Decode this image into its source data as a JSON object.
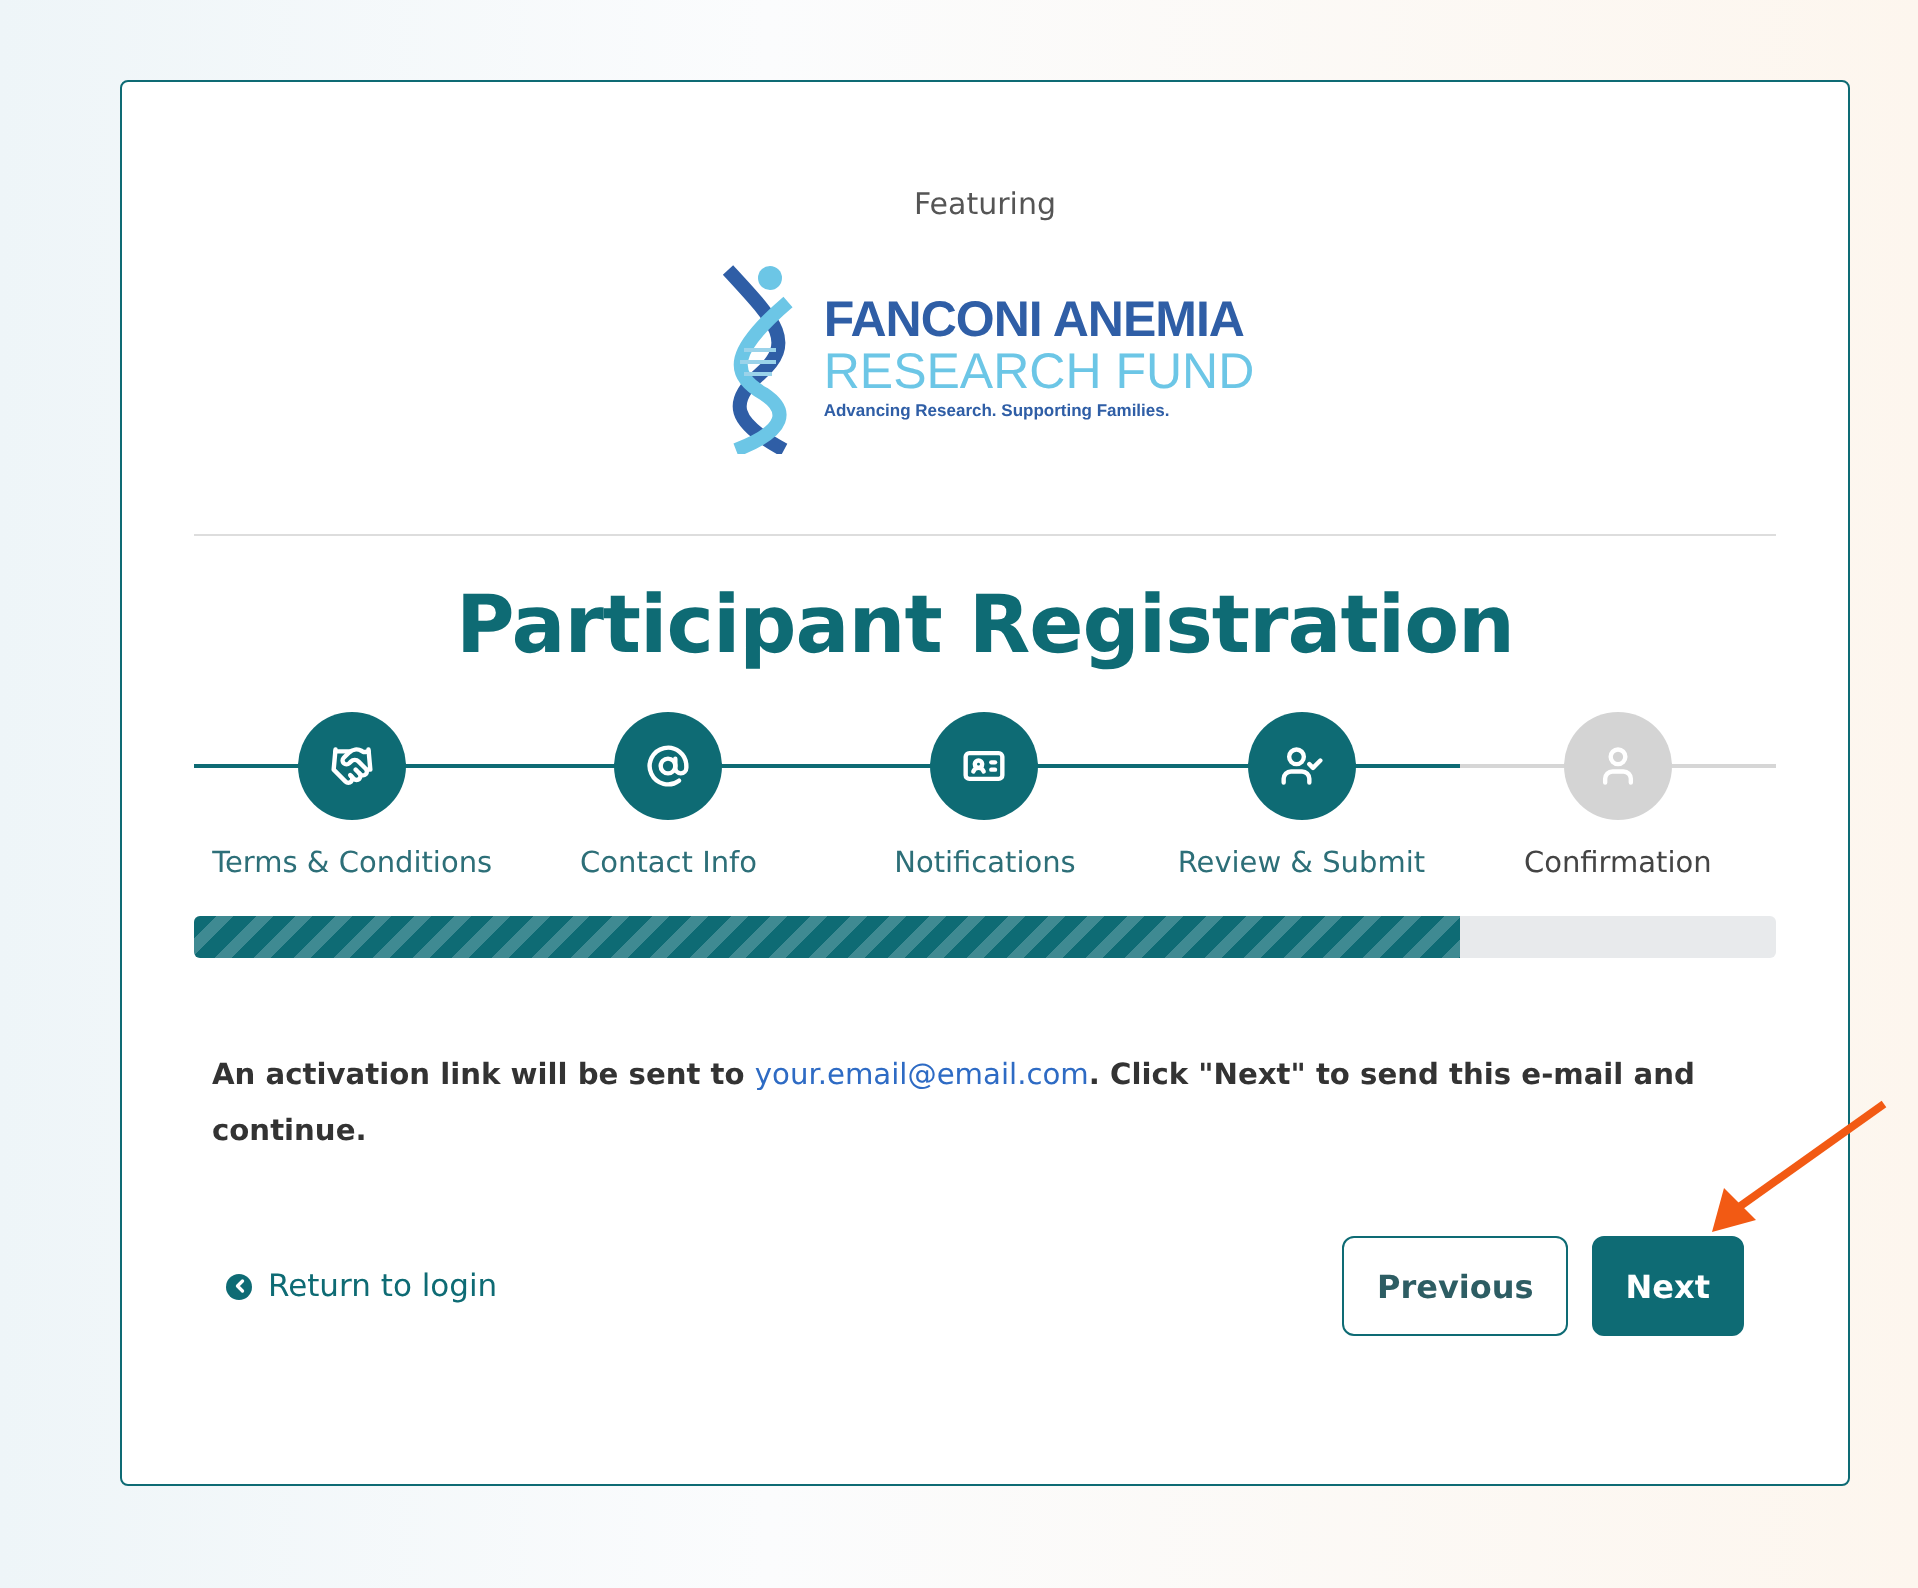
{
  "featuring": "Featuring",
  "logo": {
    "line1": "FANCONI ANEMIA",
    "line2": "RESEARCH FUND",
    "tagline": "Advancing Research. Supporting Families."
  },
  "title": "Participant Registration",
  "steps": [
    {
      "label": "Terms & Conditions",
      "completed": true
    },
    {
      "label": "Contact Info",
      "completed": true
    },
    {
      "label": "Notifications",
      "completed": true
    },
    {
      "label": "Review & Submit",
      "completed": true
    },
    {
      "label": "Confirmation",
      "completed": false
    }
  ],
  "progress": {
    "level": 0.8
  },
  "message": {
    "before": "An activation link will be sent to ",
    "link": "your.email@email.com",
    "after": ". Click \"Next\" to send this e-mail and continue."
  },
  "return_link": "Return to login",
  "buttons": [
    {
      "label": "Previous",
      "kind": "outline"
    },
    {
      "label": "Next",
      "kind": "primary"
    }
  ]
}
